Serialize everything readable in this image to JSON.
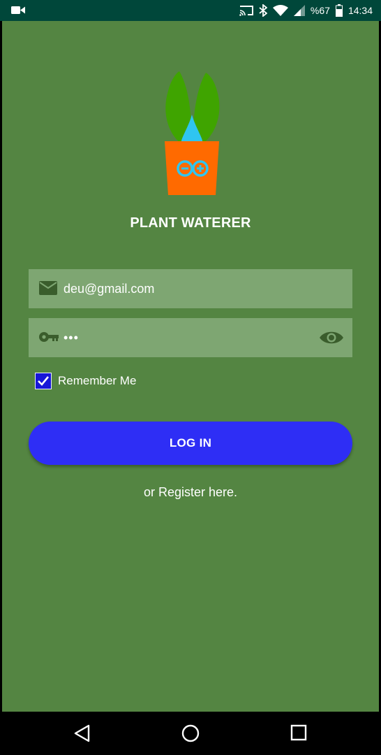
{
  "status_bar": {
    "battery": "%67",
    "time": "14:34",
    "icons": [
      "video-camera-icon",
      "cast-icon",
      "bluetooth-icon",
      "wifi-icon",
      "cellular-signal-icon",
      "battery-icon"
    ]
  },
  "app": {
    "title": "PLANT WATERER",
    "logo": "plant-pot-water-drop-logo"
  },
  "form": {
    "email_value": "deu@gmail.com",
    "email_icon": "envelope-icon",
    "password_value": "•••",
    "password_icon": "key-icon",
    "visibility_icon": "eye-icon",
    "remember_label": "Remember Me",
    "remember_checked": true,
    "login_label": "LOG IN",
    "register_text": "or Register here."
  },
  "nav_bar": {
    "buttons": [
      "back-icon",
      "home-icon",
      "recents-icon"
    ]
  },
  "colors": {
    "status_bar": "#00473a",
    "background": "#548542",
    "field": "#7ea672",
    "button": "#2e2ef5",
    "checkbox": "#1717d8",
    "pot": "#ff6a00",
    "leaf": "#3fa400",
    "drop": "#2fc5f0"
  }
}
